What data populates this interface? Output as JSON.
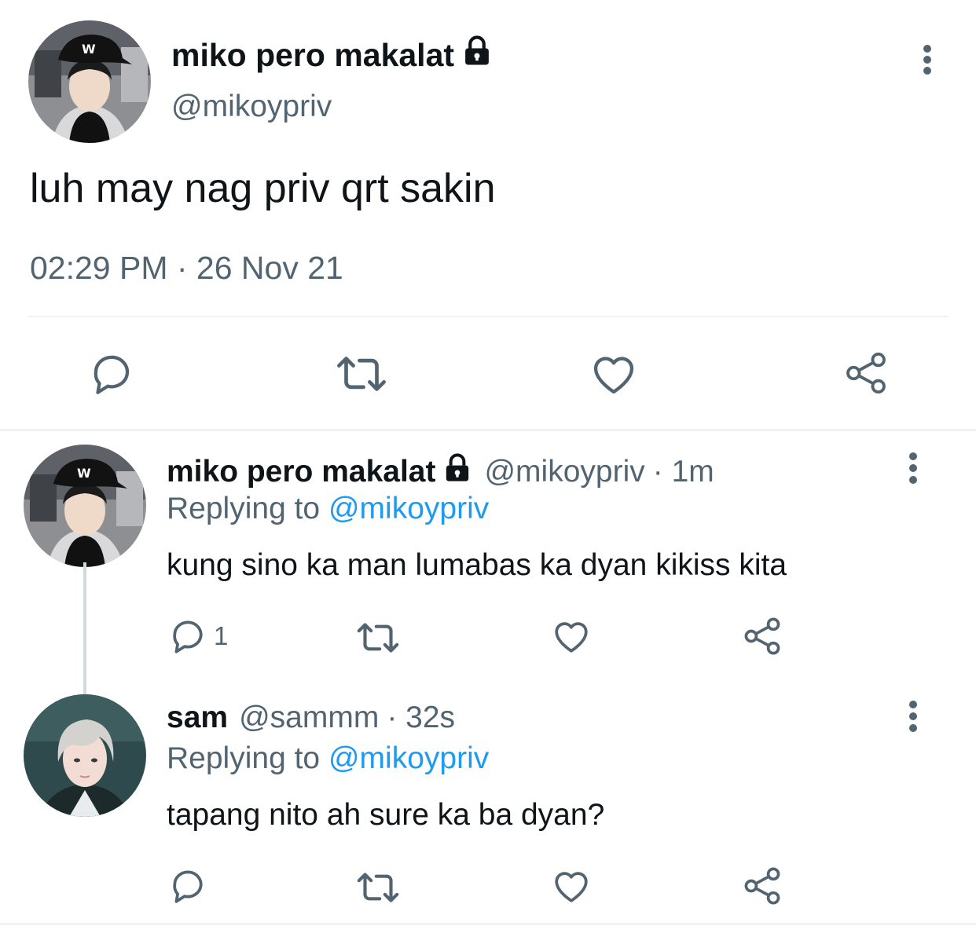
{
  "main_tweet": {
    "display_name": "miko pero makalat",
    "handle": "@mikoypriv",
    "text": "luh may nag priv qrt sakin",
    "timestamp": "02:29 PM · 26 Nov 21",
    "protected_icon": "lock-icon",
    "actions": [
      "reply-icon",
      "retweet-icon",
      "like-icon",
      "share-icon"
    ]
  },
  "replies": [
    {
      "display_name": "miko pero makalat",
      "handle": "@mikoypriv",
      "age": "· 1m",
      "replying_prefix": "Replying to",
      "replying_to": "@mikoypriv",
      "text": "kung sino ka man lumabas ka dyan kikiss kita",
      "reply_count": "1"
    },
    {
      "display_name": "sam",
      "handle": "@sammm",
      "age": "· 32s",
      "replying_prefix": "Replying to",
      "replying_to": "@mikoypriv",
      "text": "tapang nito ah sure ka ba dyan?",
      "reply_count": ""
    }
  ],
  "colors": {
    "text": "#0f1419",
    "secondary": "#536471",
    "link": "#1d9bf0",
    "divider": "#eff3f4"
  }
}
